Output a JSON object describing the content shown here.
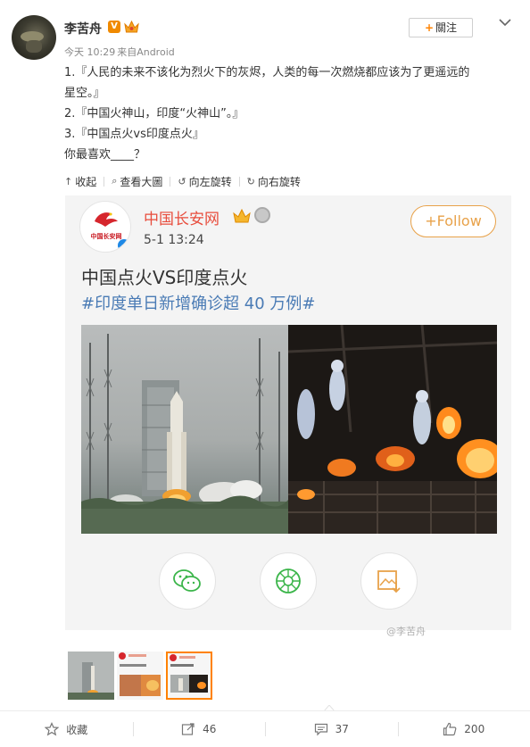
{
  "post": {
    "username": "李苦舟",
    "badge_text": "V",
    "timestamp": "今天 10:29",
    "source": "来自Android",
    "follow_label": "關注",
    "lines": [
      "1.『人民的未来不该化为烈火下的灰烬，人类的每一次燃烧都应该为了更遥远的",
      "星空。』",
      "2.『中国火神山，印度“火神山”。』",
      "3.『中国点火vs印度点火』",
      "你最喜欢____？"
    ]
  },
  "media_toolbar": {
    "collapse": "收起",
    "view_large": "查看大圖",
    "rotate_left": "向左旋转",
    "rotate_right": "向右旋转"
  },
  "card": {
    "logo_text": "中国长安网",
    "account_name": "中国长安网",
    "time": "5-1 13:24",
    "follow_label": "+Follow",
    "title": "中国点火VS印度点火",
    "hashtag": "#印度单日新增确诊超 40 万例#",
    "watermark": "@李苦舟",
    "share_icons": [
      "wechat-icon",
      "moments-icon",
      "save-image-icon"
    ]
  },
  "thumbnails": [
    {
      "name": "thumb-1",
      "selected": false
    },
    {
      "name": "thumb-2",
      "selected": false
    },
    {
      "name": "thumb-3",
      "selected": true
    }
  ],
  "footer": {
    "favorite": "收藏",
    "repost_count": "46",
    "comment_count": "37",
    "like_count": "200"
  },
  "colors": {
    "accent_orange": "#ff8200",
    "card_name_red": "#e84d3d",
    "hashtag_blue": "#4a7bb5",
    "card_follow": "#e8a24a"
  }
}
